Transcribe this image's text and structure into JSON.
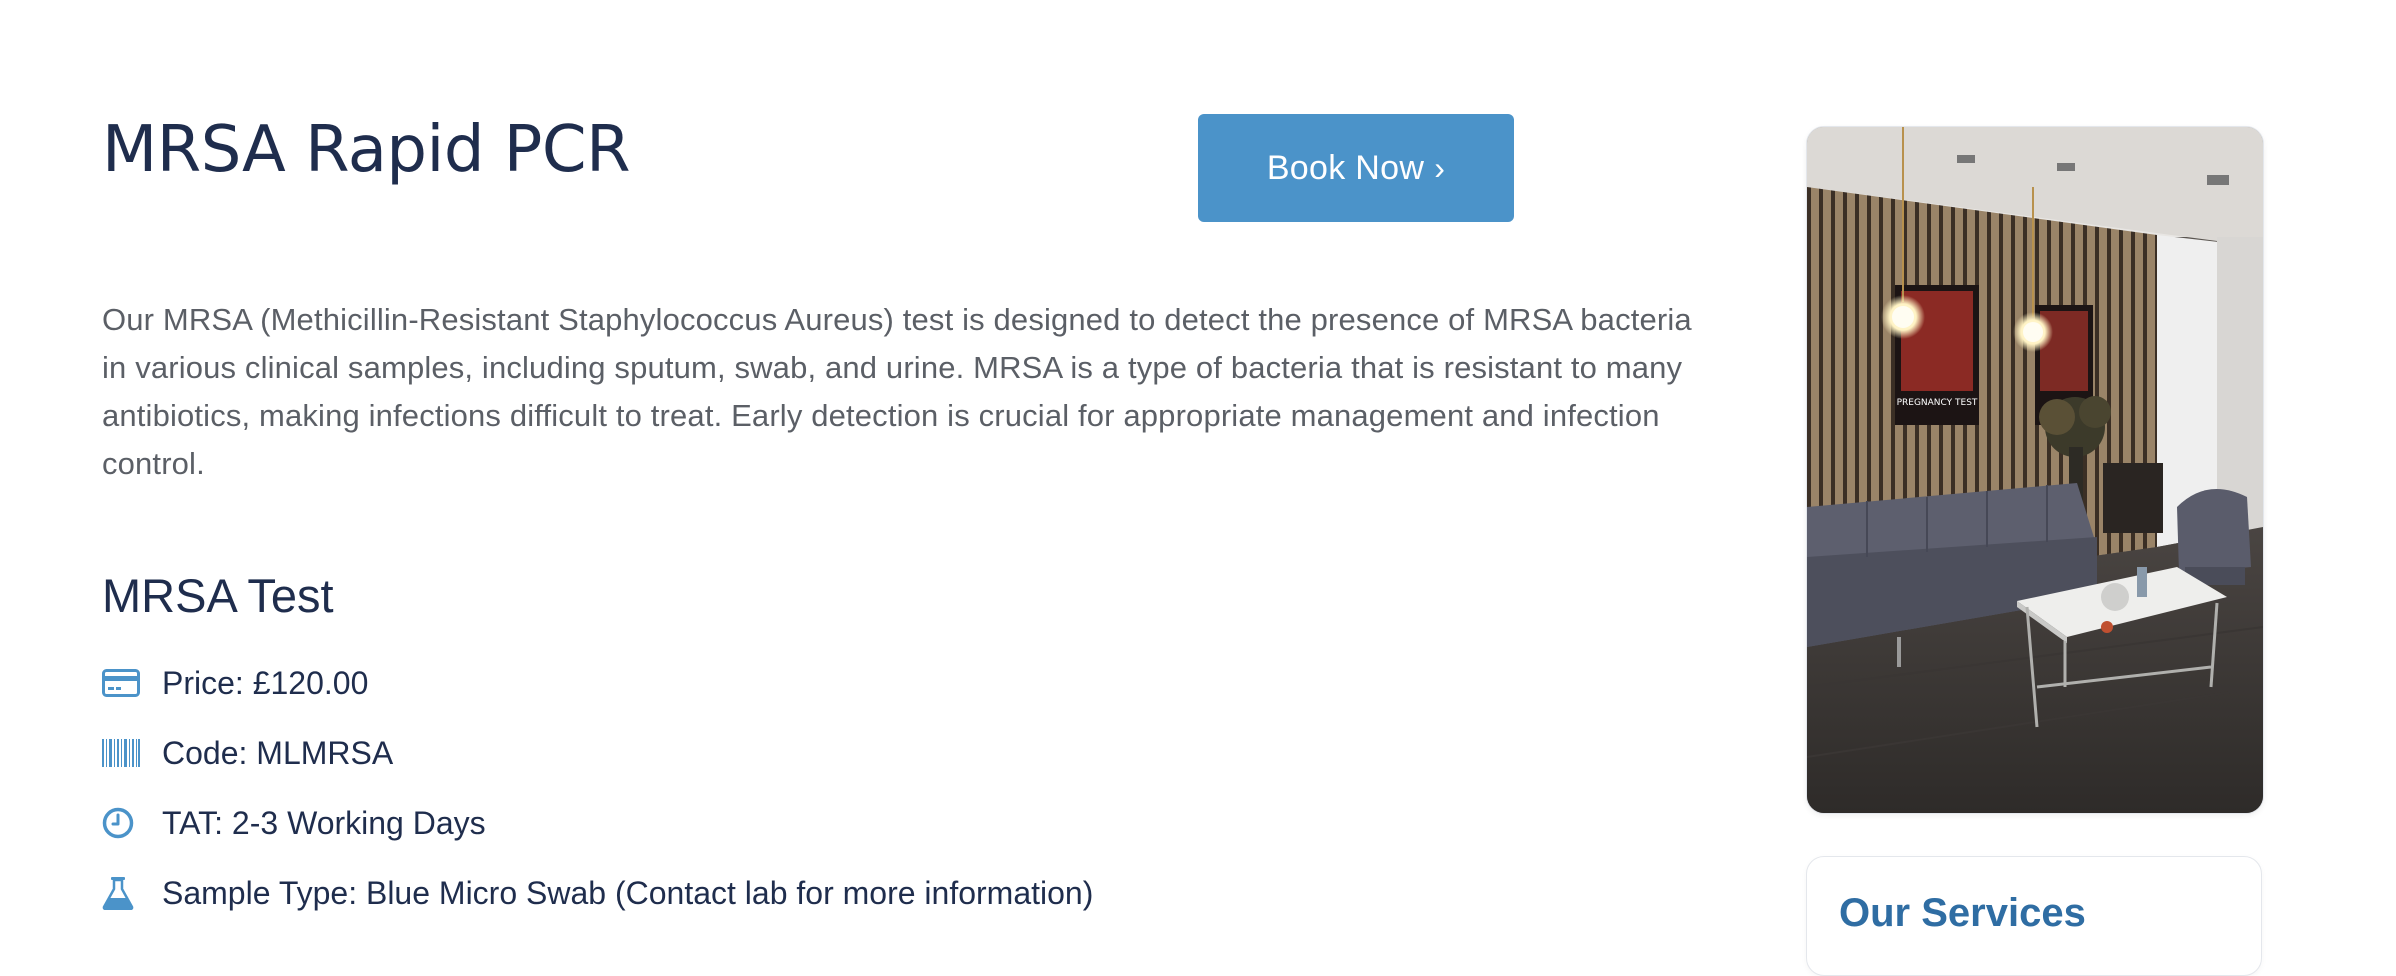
{
  "product": {
    "title": "MRSA Rapid PCR",
    "book_button": {
      "label": "Book Now",
      "chevron": "›"
    },
    "description": "Our MRSA (Methicillin-Resistant Staphylococcus Aureus) test is designed to detect the presence of MRSA bacteria in various clinical samples, including sputum, swab, and urine. MRSA is a type of bacteria that is resistant to many antibiotics, making infections difficult to treat. Early detection is crucial for appropriate management and infection control."
  },
  "test": {
    "heading": "MRSA Test",
    "details": [
      {
        "icon": "credit-card-icon",
        "text": "Price: £120.00"
      },
      {
        "icon": "barcode-icon",
        "text": "Code: MLMRSA"
      },
      {
        "icon": "clock-icon",
        "text": "TAT: 2-3 Working Days"
      },
      {
        "icon": "flask-icon",
        "text": "Sample Type: Blue Micro Swab (Contact lab for more information)"
      }
    ]
  },
  "sidebar": {
    "photo_poster_text": "PREGNANCY TEST",
    "services_title": "Our Services"
  },
  "colors": {
    "accent": "#4b93c9",
    "heading": "#1f2d4d",
    "body_text": "#5b5f66",
    "services_title": "#2f6da3"
  }
}
